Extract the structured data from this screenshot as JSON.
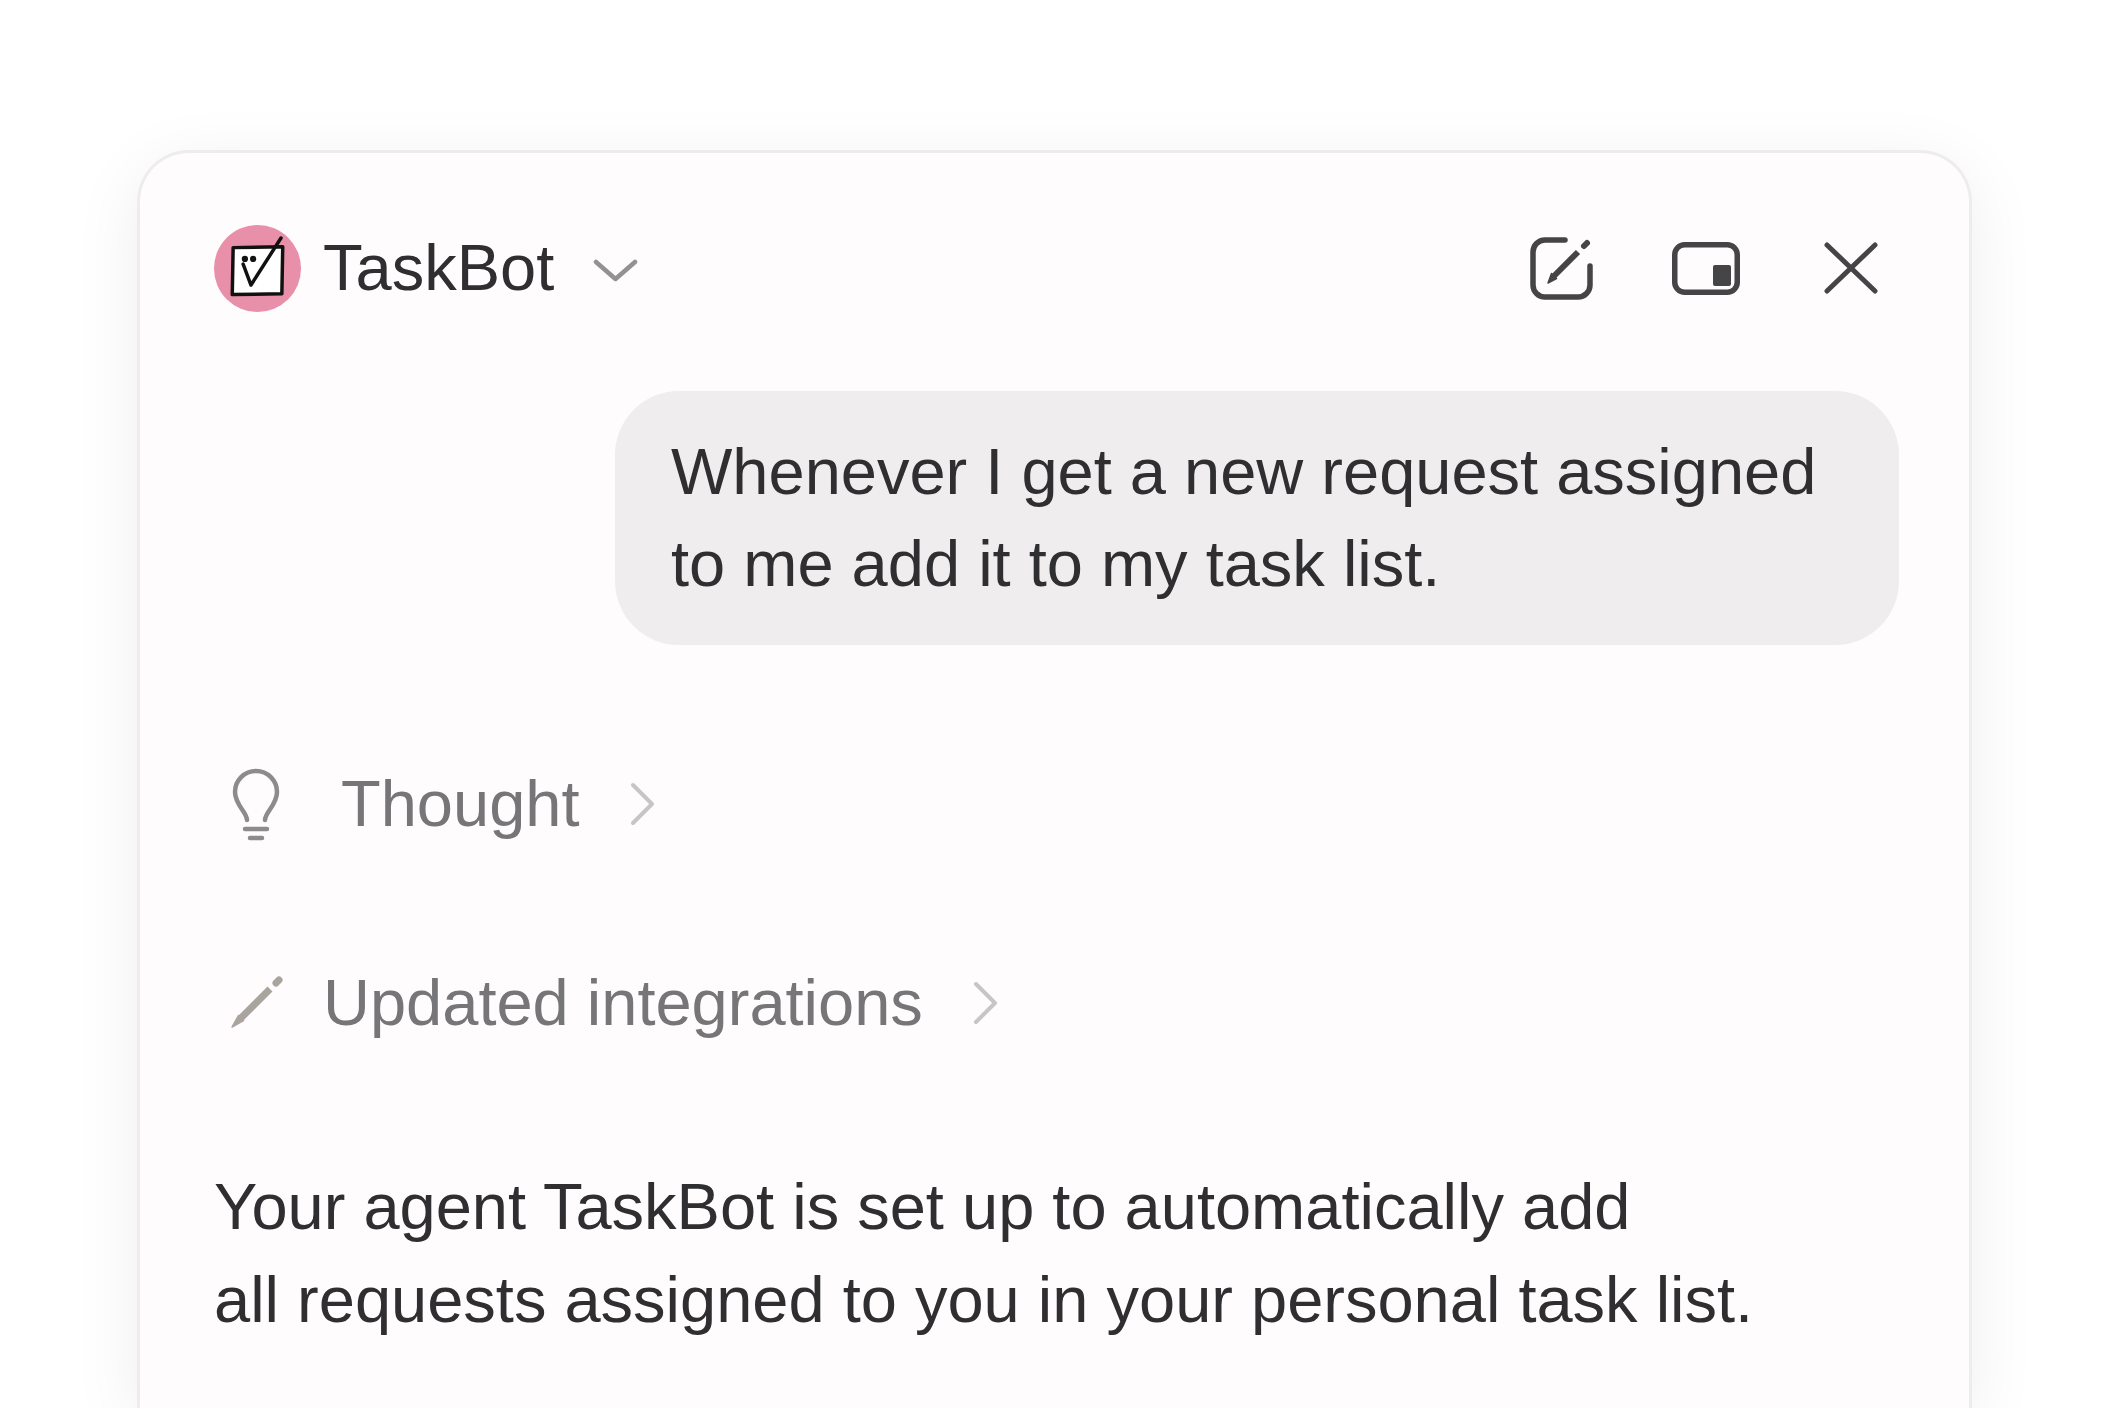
{
  "header": {
    "agent_name": "TaskBot"
  },
  "messages": [
    {
      "kind": "user",
      "text": "Whenever I get a new request assigned to me add it to my task list."
    },
    {
      "kind": "thought",
      "label": "Thought",
      "expanded": false
    },
    {
      "kind": "action",
      "label": "Updated integrations",
      "expanded": false
    },
    {
      "kind": "reply",
      "text": "Your agent TaskBot is set up to automatically add\nall requests assigned to you in your personal task list."
    }
  ]
}
